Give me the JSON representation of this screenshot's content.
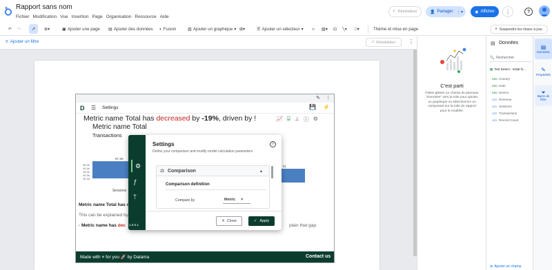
{
  "app": {
    "title": "Rapport sans nom",
    "menu": [
      "Fichier",
      "Modification",
      "Vue",
      "Insertion",
      "Page",
      "Organisation",
      "Ressource",
      "Aide"
    ],
    "reset_label": "Réinitialiser",
    "share_label": "Partager",
    "view_label": "Afficher"
  },
  "toolbar": {
    "add_page": "Ajouter une page",
    "add_data": "Ajouter des données",
    "merge": "Fusion",
    "add_chart": "Ajouter un graphique",
    "add_control": "Ajouter un sélecteur",
    "theme": "Thème et mise en page",
    "suspend": "Suspendre les mises à jour"
  },
  "filterbar": {
    "add_filter": "Ajouter un filtre",
    "reset": "Réinitialiser"
  },
  "right_panel": {
    "heading": "C'est parti",
    "text_lines": [
      "Faites glisser un champ du panneau",
      "\"Données\" vers la toile pour ajouter",
      "un graphique ou sélectionnez un",
      "composant sur la toile du rapport",
      "pour le modifier."
    ]
  },
  "data_panel": {
    "title": "Données",
    "search_placeholder": "Rechercher",
    "source": "Test Detect - Initial fo...",
    "fields": [
      {
        "type": "RBC",
        "name": "Country"
      },
      {
        "type": "RBC",
        "name": "Date"
      },
      {
        "type": "RBC",
        "name": "Device"
      },
      {
        "type": "123",
        "name": "Revenue"
      },
      {
        "type": "123",
        "name": "Sessions"
      },
      {
        "type": "123",
        "name": "Transactions"
      },
      {
        "type": "123",
        "name": "Record Count"
      }
    ],
    "add_field": "Ajouter un champ"
  },
  "side_tabs": {
    "data": "Données",
    "properties": "Propriétés",
    "filter_bar": [
      "Barre de",
      "filtre"
    ]
  },
  "widget": {
    "settings_label": "Settings",
    "headline_prefix": "Metric name Total has ",
    "headline_word": "decreased",
    "headline_mid": " by ",
    "headline_value": "-19%",
    "headline_suffix": ", driven by !",
    "subtitle": "Metric name Total",
    "sub2": "Transactions",
    "insight_title": "Metric name Total has c",
    "insight_text": "This can be explained by",
    "bullet_prefix": "· Metric name has ",
    "bullet_word": "dec",
    "bullet_suffix": "plain that gap.",
    "footer_made": "Made with",
    "footer_for": "for you",
    "footer_by": "by Datama",
    "contact": "Contact us",
    "version": "1.5.0.1",
    "bar_label_right": "K]"
  },
  "chart_data": {
    "type": "bar",
    "categories": [
      "Sessions"
    ],
    "values": [
      57.2
    ],
    "value_labels": [
      "57.2K"
    ],
    "ytick_labels": [
      "55.0k",
      "50.0k",
      "45.0k",
      "40.0k",
      "35.0k"
    ]
  },
  "dialog": {
    "title": "Settings",
    "description": "Define your comparison and modify model calculation parameters",
    "section": "Comparison",
    "subsection": "Comparison definition",
    "compare_by_label": "Compare by",
    "compare_by_value": "Metric",
    "close_label": "Close",
    "apply_label": "Apply"
  },
  "colors": {
    "accent": "#1a73e8",
    "widget_green": "#0b3d2e",
    "decrease_red": "#c5221f",
    "bar_blue": "#4a7fc1"
  }
}
